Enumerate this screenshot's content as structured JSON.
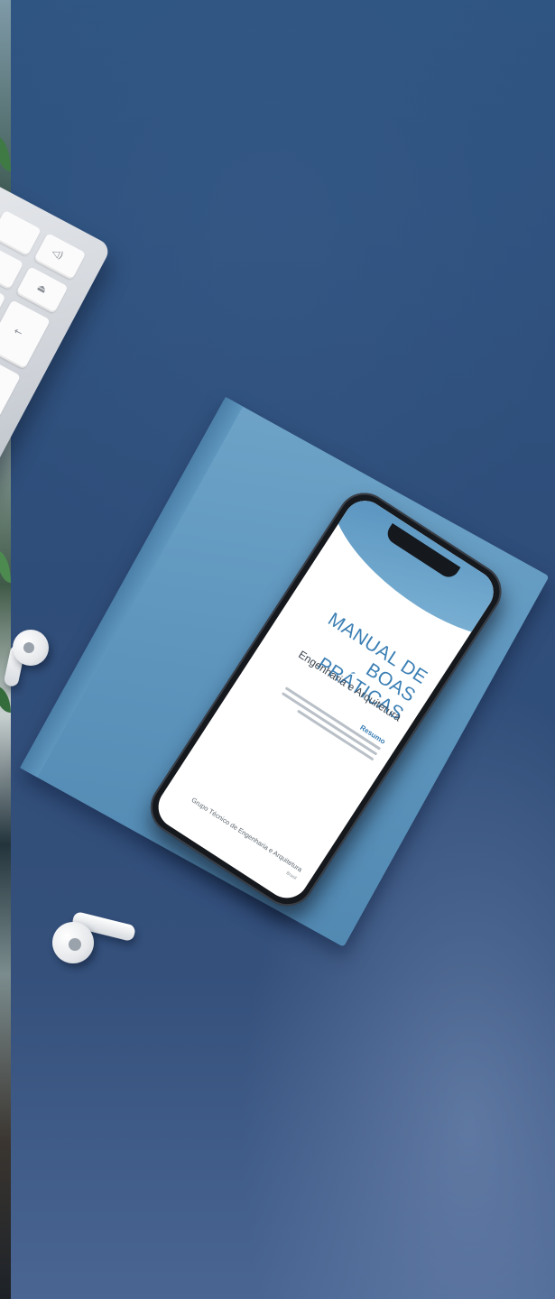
{
  "phone_screen": {
    "title_lines": [
      "MANUAL DE BOAS",
      "PRÁTICAS"
    ],
    "subtitle": "Engenharia e Arquitetura",
    "summary_heading": "Resumo",
    "footer": "Grupo Técnico de Engenharia e Arquitetura",
    "footer_small": "Brasil"
  },
  "keyboard": {
    "visible_keys": [
      "◁)",
      "⏏",
      "←",
      "↵",
      "⌂"
    ]
  },
  "colors": {
    "background": "#2f4d79",
    "notebook": "#5d95bd",
    "screen_accent": "#3b7fb4"
  }
}
